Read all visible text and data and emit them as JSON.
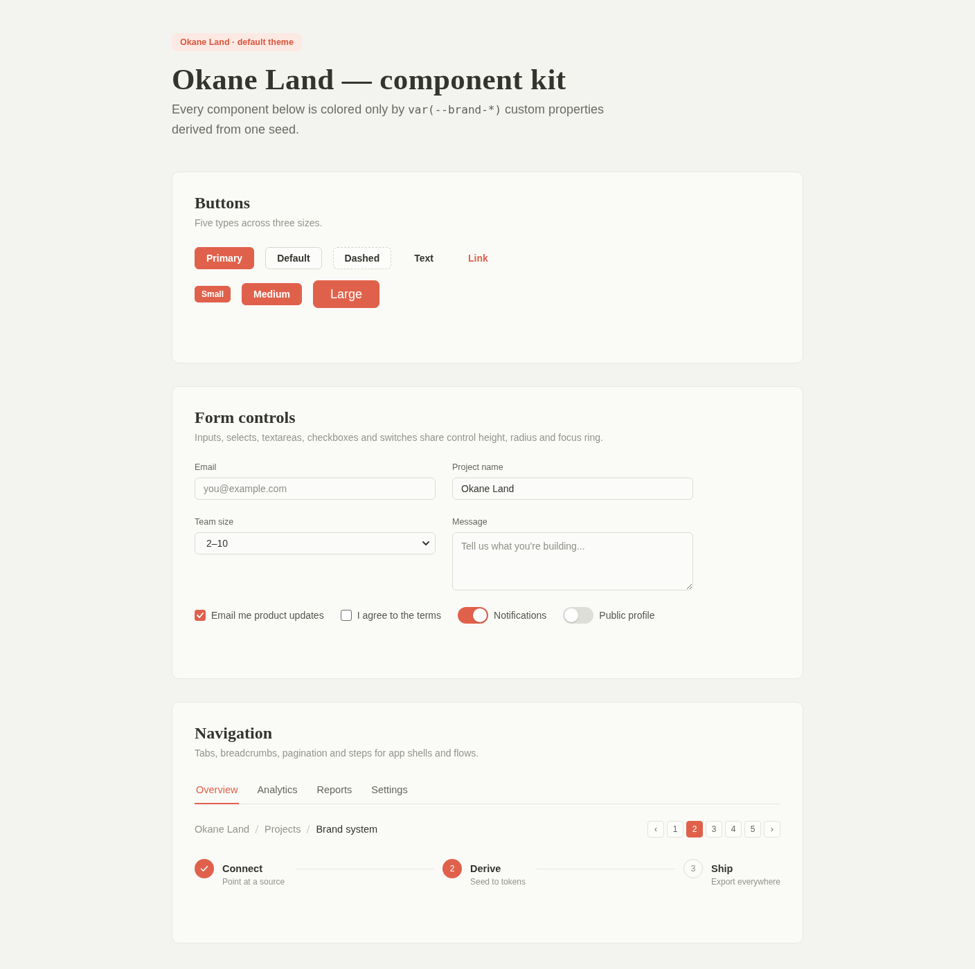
{
  "header": {
    "badge": "Okane Land · default theme",
    "title": "Okane Land — component kit",
    "subtitle": {
      "before": "Every component below is colored only by ",
      "code": "var(--brand-*)",
      "after": " custom properties derived from one seed."
    }
  },
  "buttons_card": {
    "title": "Buttons",
    "description": "Five types across three sizes.",
    "types": [
      {
        "label": "Primary",
        "kind": "primary"
      },
      {
        "label": "Default",
        "kind": "default"
      },
      {
        "label": "Dashed",
        "kind": "dashed"
      },
      {
        "label": "Text",
        "kind": "text"
      },
      {
        "label": "Link",
        "kind": "link"
      }
    ],
    "sizes": [
      {
        "label": "Small",
        "kind": "small"
      },
      {
        "label": "Medium",
        "kind": "medium"
      },
      {
        "label": "Large",
        "kind": "large"
      }
    ]
  },
  "form_card": {
    "title": "Form controls",
    "description": "Inputs, selects, textareas, checkboxes and switches share control height, radius and focus ring.",
    "fields": [
      {
        "label": "Email",
        "kind": "input",
        "placeholder": "you@example.com"
      },
      {
        "label": "Project name",
        "kind": "input",
        "value": "Okane Land"
      },
      {
        "label": "Team size",
        "kind": "select",
        "value": "2–10"
      },
      {
        "label": "Message",
        "kind": "textarea",
        "placeholder": "Tell us what you're building..."
      }
    ],
    "toggles": [
      {
        "label": "Email me product updates",
        "kind": "checkbox",
        "checked": true
      },
      {
        "label": "I agree to the terms",
        "kind": "checkbox",
        "checked": false
      },
      {
        "label": "Notifications",
        "kind": "switch",
        "on": true
      },
      {
        "label": "Public profile",
        "kind": "switch",
        "on": false
      }
    ]
  },
  "navigation_card": {
    "title": "Navigation",
    "description": "Tabs, breadcrumbs, pagination and steps for app shells and flows.",
    "tabs": [
      {
        "label": "Overview",
        "selected": true
      },
      {
        "label": "Analytics",
        "selected": false
      },
      {
        "label": "Reports",
        "selected": false
      },
      {
        "label": "Settings",
        "selected": false
      }
    ],
    "breadcrumbs": [
      {
        "label": "Okane Land",
        "current": false
      },
      {
        "label": "Projects",
        "current": false
      },
      {
        "label": "Brand system",
        "current": true
      }
    ],
    "pagination": {
      "prev": "‹",
      "pages": [
        {
          "label": "1",
          "selected": false
        },
        {
          "label": "2",
          "selected": true
        },
        {
          "label": "3",
          "selected": false
        },
        {
          "label": "4",
          "selected": false
        },
        {
          "label": "5",
          "selected": false
        }
      ],
      "next": "›"
    },
    "steps": [
      {
        "title": "Connect",
        "subtitle": "Point at a source",
        "kind": "done"
      },
      {
        "title": "Derive",
        "subtitle": "Seed to tokens",
        "number": "2",
        "kind": "current"
      },
      {
        "title": "Ship",
        "subtitle": "Export everywhere",
        "number": "3",
        "kind": "pending"
      }
    ]
  }
}
